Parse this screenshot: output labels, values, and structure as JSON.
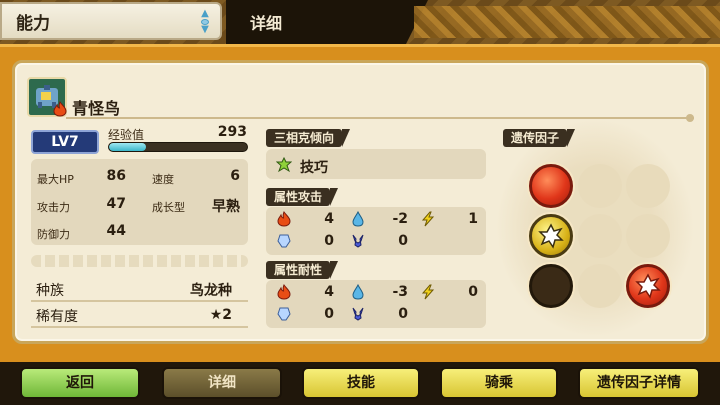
{
  "header": {
    "tab_ability": "能力",
    "tab_detail": "详细"
  },
  "monster": {
    "name": "青怪鸟",
    "level": "LV7",
    "exp_label": "经验值",
    "exp_value": "293",
    "exp_fill_fraction": 0.27
  },
  "stats": {
    "hp_label": "最大HP",
    "hp_value": "86",
    "speed_label": "速度",
    "speed_value": "6",
    "attack_label": "攻击力",
    "attack_value": "47",
    "growth_label": "成长型",
    "growth_value": "早熟",
    "defense_label": "防御力",
    "defense_value": "44"
  },
  "info": {
    "species_label": "种族",
    "species_value": "鸟龙种",
    "rarity_label": "稀有度",
    "rarity_value": "★2"
  },
  "triangle": {
    "title": "三相克倾向",
    "value": "技巧",
    "icon": "technique-icon"
  },
  "elem_attack": {
    "title": "属性攻击",
    "fire": "4",
    "water": "-2",
    "thunder": "1",
    "ice": "0",
    "dragon": "0"
  },
  "elem_resist": {
    "title": "属性耐性",
    "fire": "4",
    "water": "-3",
    "thunder": "0",
    "ice": "0",
    "dragon": "0"
  },
  "genes": {
    "title": "遗传因子"
  },
  "buttons": {
    "back": "返回",
    "detail": "详细",
    "skills": "技能",
    "riding": "骑乘",
    "gene_detail": "遗传因子详情"
  },
  "colors": {
    "frame_orange": "#d88f1d",
    "panel_cream": "#f4ecd6",
    "level_blue": "#243a78",
    "gene_red": "#e0361a",
    "gene_yellow": "#d8b218"
  }
}
